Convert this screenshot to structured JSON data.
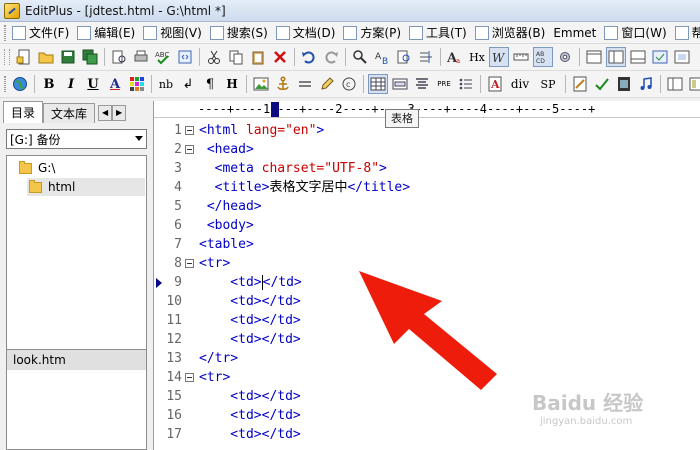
{
  "window": {
    "title": "EditPlus - [jdtest.html - G:\\html *]"
  },
  "menu": [
    {
      "label": "文件(F)",
      "icon": "file-icon"
    },
    {
      "label": "编辑(E)",
      "icon": "edit-icon"
    },
    {
      "label": "视图(V)",
      "icon": "view-icon"
    },
    {
      "label": "搜索(S)",
      "icon": "search-icon"
    },
    {
      "label": "文档(D)",
      "icon": "document-icon"
    },
    {
      "label": "方案(P)",
      "icon": "project-icon"
    },
    {
      "label": "工具(T)",
      "icon": "tools-icon"
    },
    {
      "label": "浏览器(B)",
      "icon": "browser-icon"
    },
    {
      "label": "Emmet",
      "icon": ""
    },
    {
      "label": "窗口(W)",
      "icon": "window-icon"
    },
    {
      "label": "帮助(H)",
      "icon": "help-icon"
    }
  ],
  "toolbar2": {
    "bold": "B",
    "italic": "I",
    "underline": "U",
    "font_color": "A",
    "nbsp": "nb",
    "br": "↲",
    "para": "¶",
    "heading": "H",
    "pre": "PRE",
    "div": "div",
    "span": "SP",
    "hex": "Hx"
  },
  "left_panel": {
    "tabs": [
      "目录",
      "文本库"
    ],
    "drive": "[G:] 备份",
    "tree": [
      {
        "label": "G:\\"
      },
      {
        "label": "html"
      }
    ],
    "files": [
      "look.htm"
    ]
  },
  "ruler": {
    "text": "----+----1----+----2----+----3----+----4----+----5----+"
  },
  "tooltip": "表格",
  "editor": {
    "lines": [
      {
        "n": "1",
        "tokens": [
          {
            "t": "<html ",
            "c": "tag"
          },
          {
            "t": "lang=",
            "c": "attr"
          },
          {
            "t": "\"en\"",
            "c": "str"
          },
          {
            "t": ">",
            "c": "tag"
          }
        ]
      },
      {
        "n": "2",
        "tokens": [
          {
            "t": " <head>",
            "c": "tag"
          }
        ]
      },
      {
        "n": "3",
        "tokens": [
          {
            "t": "  <meta ",
            "c": "tag"
          },
          {
            "t": "charset=",
            "c": "attr"
          },
          {
            "t": "\"UTF-8\"",
            "c": "str"
          },
          {
            "t": ">",
            "c": "tag"
          }
        ]
      },
      {
        "n": "4",
        "tokens": [
          {
            "t": "  <title>",
            "c": "tag"
          },
          {
            "t": "表格文字居中",
            "c": "txt"
          },
          {
            "t": "</title>",
            "c": "tag"
          }
        ]
      },
      {
        "n": "5",
        "tokens": [
          {
            "t": " </head>",
            "c": "tag"
          }
        ]
      },
      {
        "n": "6",
        "tokens": [
          {
            "t": " <body>",
            "c": "tag"
          }
        ]
      },
      {
        "n": "7",
        "tokens": [
          {
            "t": "<table>",
            "c": "tag"
          }
        ]
      },
      {
        "n": "8",
        "tokens": [
          {
            "t": "<tr>",
            "c": "tag"
          }
        ]
      },
      {
        "n": "9",
        "tokens": [
          {
            "t": "    <td>",
            "c": "tag"
          },
          {
            "t": "|",
            "c": "caret"
          },
          {
            "t": "</td>",
            "c": "tag"
          }
        ]
      },
      {
        "n": "10",
        "tokens": [
          {
            "t": "    <td></td>",
            "c": "tag"
          }
        ]
      },
      {
        "n": "11",
        "tokens": [
          {
            "t": "    <td></td>",
            "c": "tag"
          }
        ]
      },
      {
        "n": "12",
        "tokens": [
          {
            "t": "    <td></td>",
            "c": "tag"
          }
        ]
      },
      {
        "n": "13",
        "tokens": [
          {
            "t": "</tr>",
            "c": "tag"
          }
        ]
      },
      {
        "n": "14",
        "tokens": [
          {
            "t": "<tr>",
            "c": "tag"
          }
        ]
      },
      {
        "n": "15",
        "tokens": [
          {
            "t": "    <td></td>",
            "c": "tag"
          }
        ]
      },
      {
        "n": "16",
        "tokens": [
          {
            "t": "    <td></td>",
            "c": "tag"
          }
        ]
      },
      {
        "n": "17",
        "tokens": [
          {
            "t": "    <td></td>",
            "c": "tag"
          }
        ]
      }
    ],
    "fold_lines": [
      "1",
      "2",
      "8",
      "14"
    ],
    "bookmark_line": "9"
  },
  "annotation": {
    "color": "#ee1c0a",
    "icon": "red-arrow-pointer"
  },
  "watermark": {
    "main": "Baidu 经验",
    "sub": "jingyan.baidu.com"
  }
}
